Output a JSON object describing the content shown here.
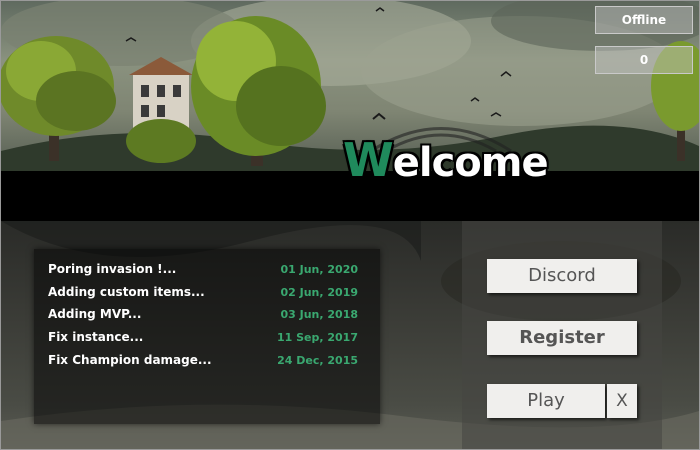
{
  "status": {
    "server": "Offline",
    "players": "0"
  },
  "welcome": {
    "first": "W",
    "rest": "elcome"
  },
  "news": [
    {
      "title": "Poring invasion !...",
      "date": "01 Jun, 2020"
    },
    {
      "title": "Adding custom items...",
      "date": "02 Jun, 2019"
    },
    {
      "title": "Adding MVP...",
      "date": "03 Jun, 2018"
    },
    {
      "title": "Fix instance...",
      "date": "11 Sep, 2017"
    },
    {
      "title": "Fix Champion damage...",
      "date": "24 Dec, 2015"
    }
  ],
  "buttons": {
    "discord": "Discord",
    "register": "Register",
    "play": "Play",
    "close": "X"
  },
  "colors": {
    "accent": "#1f8a5c",
    "date": "#3aa870",
    "button_bg": "#f0efed"
  }
}
